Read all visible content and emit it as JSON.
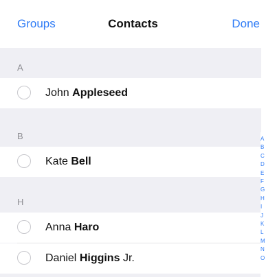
{
  "navbar": {
    "left_label": "Groups",
    "title": "Contacts",
    "right_label": "Done"
  },
  "sections": [
    {
      "letter": "A",
      "contacts": [
        {
          "first": "John",
          "last": "Appleseed",
          "suffix": ""
        }
      ]
    },
    {
      "letter": "B",
      "contacts": [
        {
          "first": "Kate",
          "last": "Bell",
          "suffix": ""
        }
      ]
    },
    {
      "letter": "H",
      "contacts": [
        {
          "first": "Anna",
          "last": "Haro",
          "suffix": ""
        },
        {
          "first": "Daniel",
          "last": "Higgins",
          "suffix": "Jr."
        }
      ]
    }
  ],
  "index_letters": [
    "A",
    "B",
    "C",
    "D",
    "E",
    "F",
    "G",
    "H",
    "I",
    "J",
    "K",
    "L",
    "M",
    "N",
    "O"
  ],
  "colors": {
    "accent": "#2f7cf6",
    "section_bg": "#efeff4",
    "radio_border": "#c7c7cc"
  }
}
